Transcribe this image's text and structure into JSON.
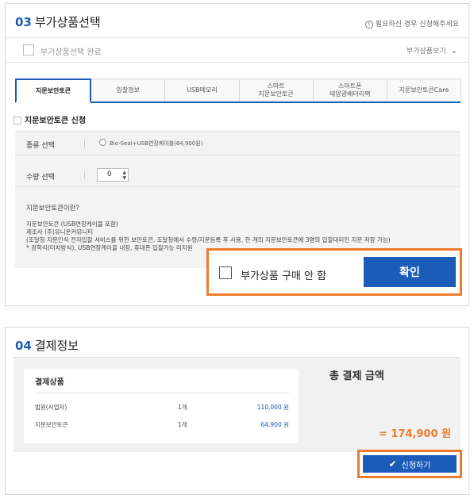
{
  "addon": {
    "section_num": "03",
    "section_title": "부가상품선택",
    "note": "필요하신 경우 신청해주세요",
    "done_label": "부가상품선택 완료",
    "view_label": "부가상품보기",
    "tabs": [
      "지문보안토큰",
      "입찰정보",
      "USB메모리",
      "스마트\n지문보안토큰",
      "스마트폰\n태양광배터리팩",
      "지문보안토큰Care"
    ],
    "apply_label": "지문보안토큰 신청",
    "type_label": "종류 선택",
    "type_option": "Bio-Seal+USB연장케이블(64,900원)",
    "qty_label": "수량 선택",
    "qty_value": "0",
    "desc_title": "지문보안토큰이란?",
    "desc_lines": [
      "지문보안토큰 (USB연장케이블 포함)",
      "제조사 (주)유니온커뮤니티",
      "(조달청 지문인식 전자입찰 서비스를 위한 보안토큰, 조달청에서 수령/지문등록 후 사용, 한 개의 지문보안토큰에 3명의 입찰대리인 지문 저장 가능)",
      "* 광학식(터치방식), USB연장케이블 내장, 휴대폰 입찰가능 미지원"
    ],
    "no_purchase_label": "부가상품 구매 안 함",
    "confirm_label": "확인"
  },
  "payment": {
    "section_num": "04",
    "section_title": "결제정보",
    "items_title": "결제상품",
    "items": [
      {
        "name": "법원(사업자)",
        "qty": "1개",
        "price": "110,000 원"
      },
      {
        "name": "지문보안토큰",
        "qty": "1개",
        "price": "64,900 원"
      }
    ],
    "total_label": "총 결제 금액",
    "total_value": "= 174,900 원",
    "apply_button": "신청하기"
  },
  "colors": {
    "accent": "#1c5bb8",
    "highlight": "#ee7b2c"
  }
}
